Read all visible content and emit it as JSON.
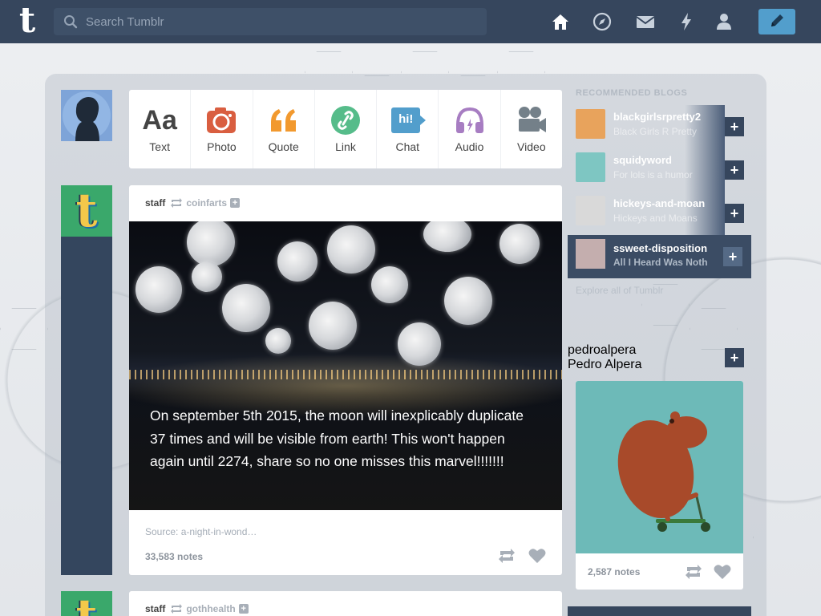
{
  "search": {
    "placeholder": "Search Tumblr"
  },
  "logo": "t",
  "nav": {
    "icons": [
      "home-icon",
      "explore-compass-icon",
      "messages-envelope-icon",
      "activity-lightning-icon",
      "account-person-icon"
    ],
    "compose_icon": "pencil-icon",
    "accent": "#529ecc",
    "bar_color": "#36465d"
  },
  "post_types": [
    {
      "label": "Text",
      "icon": "Aa",
      "color": "#444444"
    },
    {
      "label": "Photo",
      "icon": "camera-icon",
      "color": "#d95e40"
    },
    {
      "label": "Quote",
      "icon": "quote-icon",
      "color": "#f2992e"
    },
    {
      "label": "Link",
      "icon": "link-icon",
      "color": "#56bc8a"
    },
    {
      "label": "Chat",
      "icon": "hi!",
      "color": "#529ecc"
    },
    {
      "label": "Audio",
      "icon": "headphones-icon",
      "color": "#a77dc2"
    },
    {
      "label": "Video",
      "icon": "camera-video-icon",
      "color": "#748089"
    }
  ],
  "post": {
    "author": "staff",
    "reblogged_from": "coinfarts",
    "caption": "On september 5th 2015, the moon will inexplicably duplicate 37 times and will be visible from earth! This won't happen again until 2274, share so no one misses this marvel!!!!!!!",
    "source": "Source: a-night-in-wond…",
    "notes": "33,583 notes"
  },
  "post2": {
    "author": "staff",
    "reblogged_from": "gothhealth"
  },
  "sidebar": {
    "title": "RECOMMENDED BLOGS",
    "blogs": [
      {
        "name": "blackgirlsrpretty2",
        "subtitle": "Black Girls R Pretty"
      },
      {
        "name": "squidyword",
        "subtitle": "For lols is a humor"
      },
      {
        "name": "hickeys-and-moan",
        "subtitle": "Hickeys and Moans"
      },
      {
        "name": "ssweet-disposition",
        "subtitle": "All I Heard Was Noth"
      }
    ],
    "explore": "Explore all of Tumblr",
    "radar": {
      "name": "pedroalpera",
      "subtitle": "Pedro Alpera",
      "notes": "2,587 notes"
    }
  }
}
